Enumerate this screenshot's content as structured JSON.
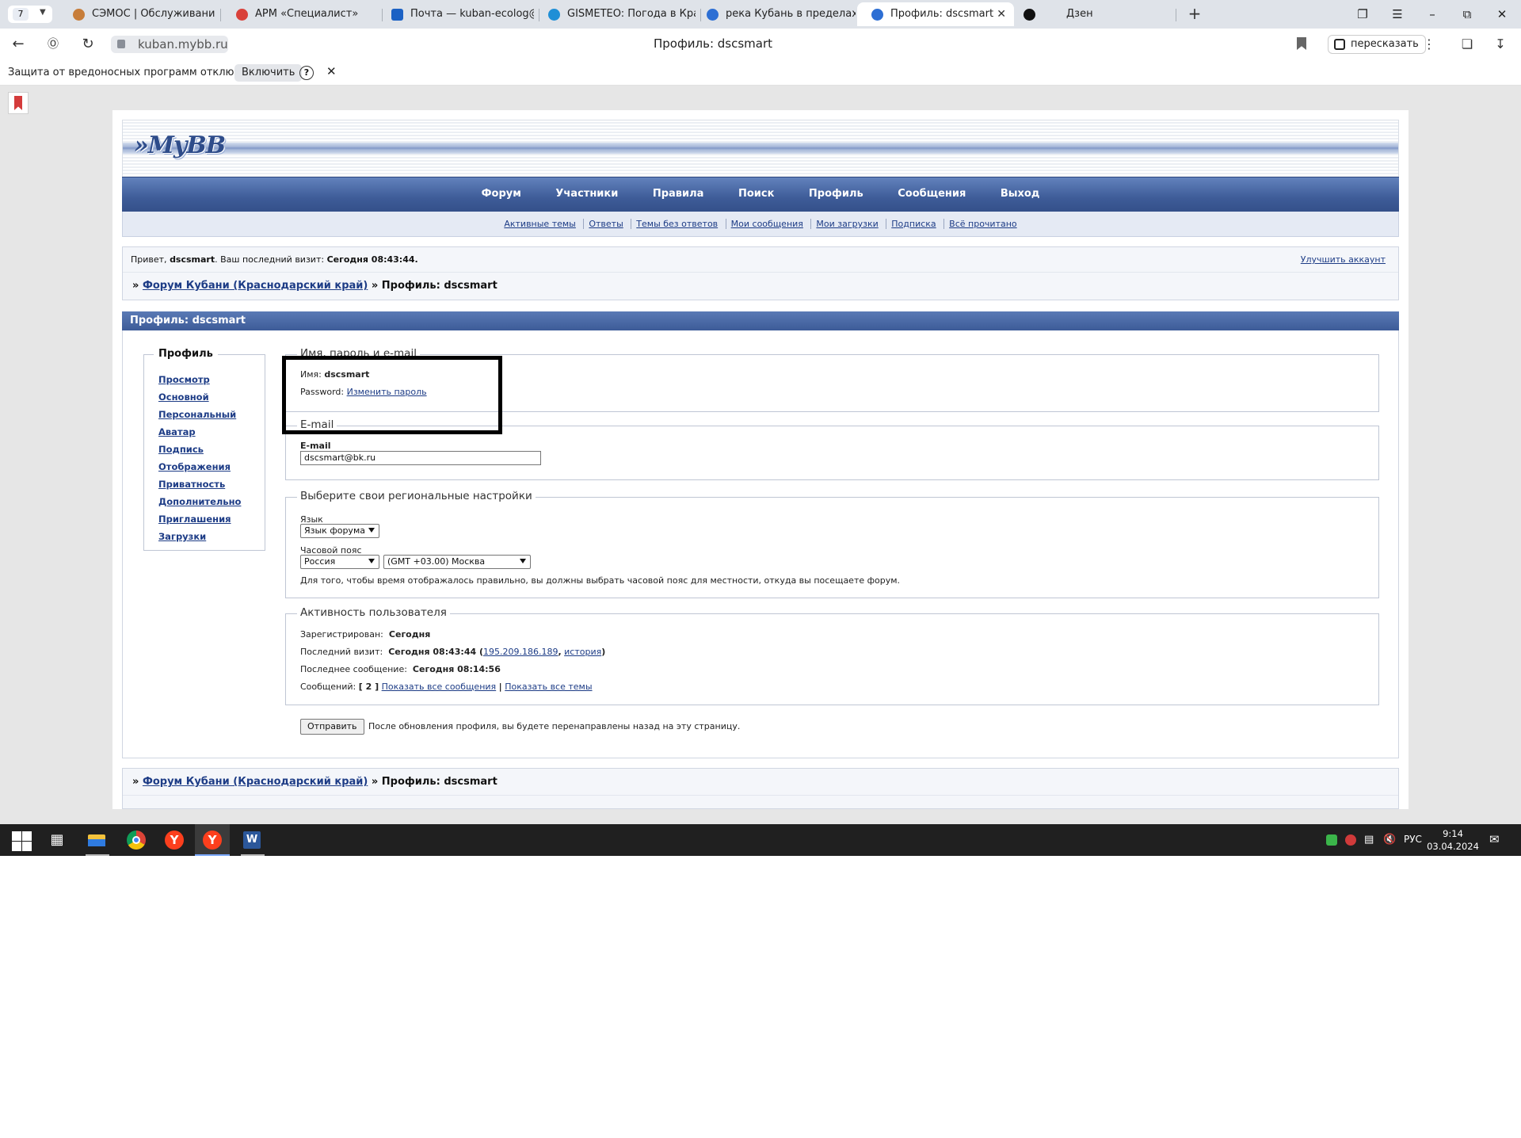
{
  "browser": {
    "tab_count": "7",
    "tabs": [
      {
        "label": "СЭМОС | Обслуживание",
        "color": "#c77d3a"
      },
      {
        "label": "АРМ «Специалист»",
        "color": "#d9413a"
      },
      {
        "label": "Почта — kuban-ecolog@k",
        "color": "#1b61c4"
      },
      {
        "label": "GISMETEO: Погода в Крас",
        "color": "#1f8fd6"
      },
      {
        "label": "река Кубань в пределах г.",
        "color": "#2d6fd4"
      },
      {
        "label": "Профиль: dscsmart",
        "color": "#2d6fd4"
      },
      {
        "label": "Дзен",
        "color": "#111111"
      }
    ],
    "active_tab_close": "✕",
    "new_tab": "+",
    "url": "kuban.mybb.ru",
    "page_title": "Профиль: dscsmart",
    "retell_label": "пересказать",
    "infobar": {
      "message": "Защита от вредоносных программ отключена",
      "enable_label": "Включить",
      "help": "?",
      "close": "✕"
    }
  },
  "forum": {
    "logo": "»MyBB",
    "menu": [
      "Форум",
      "Участники",
      "Правила",
      "Поиск",
      "Профиль",
      "Сообщения",
      "Выход"
    ],
    "submenu": [
      "Активные темы",
      "Ответы",
      "Темы без ответов",
      "Мои сообщения",
      "Мои загрузки",
      "Подписка",
      "Всё прочитано"
    ],
    "greeting_prefix": "Привет,",
    "username": "dscsmart",
    "last_visit_prefix": ". Ваш последний визит:",
    "last_visit_value": "Сегодня 08:43:44.",
    "upgrade_label": "Улучшить аккаунт",
    "crumb_sep": "»",
    "crumb_forum": "Форум Кубани (Краснодарский край)",
    "crumb_current": "» Профиль: dscsmart",
    "section_title": "Профиль: dscsmart",
    "nav": {
      "legend": "Профиль",
      "items": [
        "Просмотр",
        "Основной",
        "Персональный",
        "Аватар",
        "Подпись",
        "Отображения",
        "Приватность",
        "Дополнительно",
        "Приглашения",
        "Загрузки"
      ]
    },
    "name_fs": {
      "legend": "Имя, пароль и e-mail",
      "name_label": "Имя:",
      "name_value": "dscsmart",
      "password_label": "Password:",
      "password_link": "Изменить пароль"
    },
    "email_fs": {
      "legend": "E-mail",
      "label": "E-mail",
      "value": "dscsmart@bk.ru"
    },
    "regional_fs": {
      "legend": "Выберите свои региональные настройки",
      "lang_label": "Язык",
      "lang_value": "Язык форума",
      "tz_label": "Часовой пояс",
      "tz_country": "Россия",
      "tz_value": "(GMT +03.00) Москва",
      "note": "Для того, чтобы время отображалось правильно, вы должны выбрать часовой пояс для местности, откуда вы посещаете форум."
    },
    "activity_fs": {
      "legend": "Активность пользователя",
      "registered_label": "Зарегистрирован:",
      "registered_value": "Сегодня",
      "last_visit_label": "Последний визит:",
      "last_visit_value": "Сегодня 08:43:44 (",
      "ip": "195.209.186.189",
      "comma": ",",
      "history_link": "история",
      "close_paren": ")",
      "last_post_label": "Последнее сообщение:",
      "last_post_value": "Сегодня 08:14:56",
      "posts_label": "Сообщений:",
      "posts_value": "[ 2 ]",
      "show_posts": "Показать все сообщения",
      "pipe": "|",
      "show_topics": "Показать все темы"
    },
    "submit_label": "Отправить",
    "submit_note": "После обновления профиля, вы будете перенаправлены назад на эту страницу."
  },
  "taskbar": {
    "lang": "РУС",
    "time": "9:14",
    "date": "03.04.2024"
  }
}
